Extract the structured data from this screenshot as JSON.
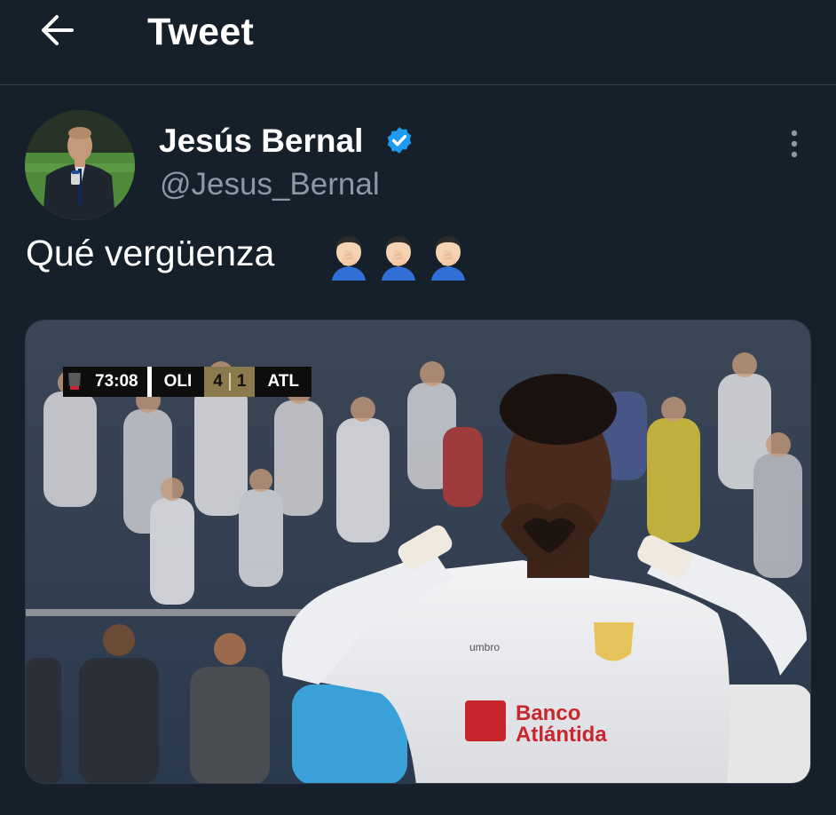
{
  "header": {
    "title": "Tweet",
    "back_icon": "arrow-left-icon"
  },
  "author": {
    "name": "Jesús Bernal",
    "handle": "@Jesus_Bernal",
    "verified": true,
    "verified_color": "#1d9bf0"
  },
  "tweet": {
    "text": "Qué vergüenza",
    "emojis": [
      "face-palm-emoji",
      "face-palm-emoji",
      "face-palm-emoji"
    ]
  },
  "media": {
    "scoreboard": {
      "time": "73:08",
      "home_team": "OLI",
      "home_score": "4",
      "away_score": "1",
      "away_team": "ATL"
    },
    "jersey_sponsor_line1": "Banco",
    "jersey_sponsor_line2": "Atlántida",
    "jersey_brand": "umbro"
  },
  "colors": {
    "background": "#15202b",
    "divider": "#38444d",
    "secondary_text": "#8b98a5",
    "accent": "#1d9bf0"
  }
}
